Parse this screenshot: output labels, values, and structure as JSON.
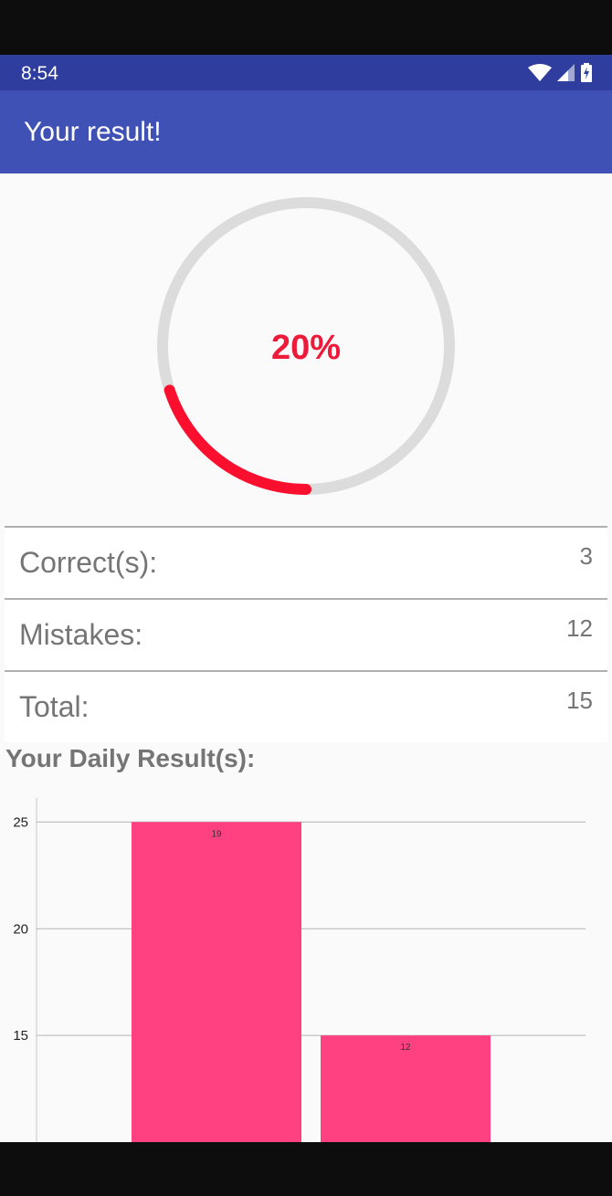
{
  "status_bar": {
    "time": "8:54",
    "icons": [
      "wifi-icon",
      "cell-signal-icon",
      "battery-charging-icon"
    ]
  },
  "app_bar": {
    "title": "Your result!"
  },
  "progress": {
    "percent_label": "20%",
    "value": 0.2,
    "track_color": "#dcdcdc",
    "progress_color": "#fb0f2f"
  },
  "stats": [
    {
      "label": "Correct(s):",
      "value": "3"
    },
    {
      "label": "Mistakes:",
      "value": "12"
    },
    {
      "label": "Total:",
      "value": "15"
    }
  ],
  "daily_title": "Your Daily Result(s):",
  "chart_data": {
    "type": "bar",
    "title": "",
    "xlabel": "",
    "ylabel": "",
    "ylim": [
      10,
      26.3
    ],
    "y_ticks": [
      15,
      20,
      25
    ],
    "grid": true,
    "bar_color": "#ff4081",
    "values": [
      25,
      15
    ],
    "value_labels": [
      "19",
      "12"
    ]
  }
}
